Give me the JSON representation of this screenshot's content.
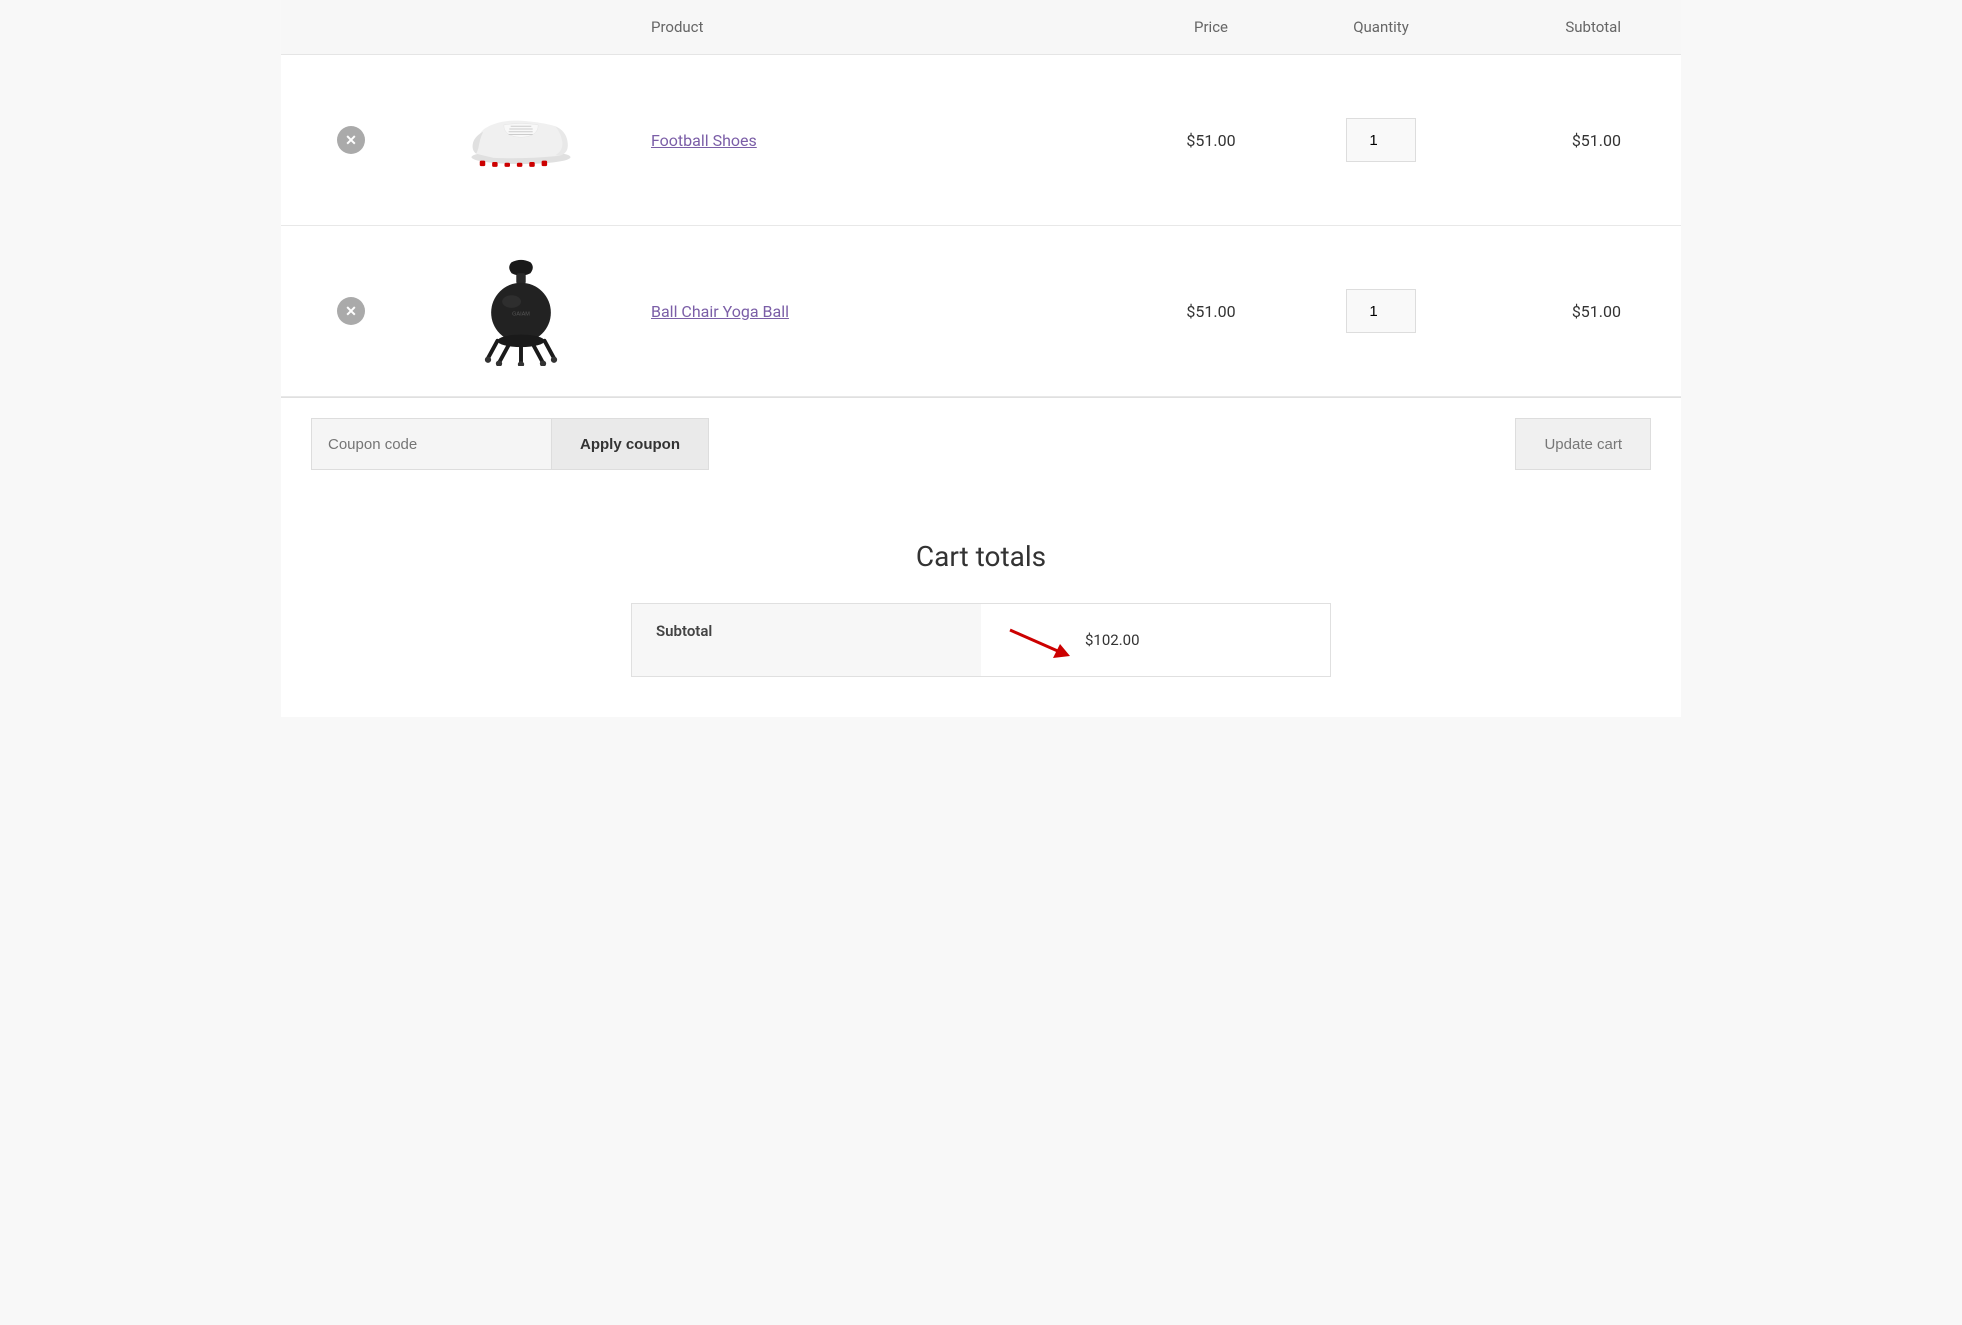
{
  "header": {
    "columns": {
      "product": "Product",
      "price": "Price",
      "quantity": "Quantity",
      "subtotal": "Subtotal"
    }
  },
  "cart": {
    "items": [
      {
        "id": "football-shoes",
        "name": "Football Shoes",
        "price": "$51.00",
        "quantity": 1,
        "subtotal": "$51.00",
        "image_type": "shoe"
      },
      {
        "id": "ball-chair",
        "name": "Ball Chair Yoga Ball",
        "price": "$51.00",
        "quantity": 1,
        "subtotal": "$51.00",
        "image_type": "chair"
      }
    ]
  },
  "coupon": {
    "placeholder": "Coupon code",
    "apply_label": "Apply coupon",
    "update_label": "Update cart"
  },
  "totals": {
    "title": "Cart totals",
    "rows": [
      {
        "label": "Subtotal",
        "value": "$102.00"
      }
    ]
  }
}
